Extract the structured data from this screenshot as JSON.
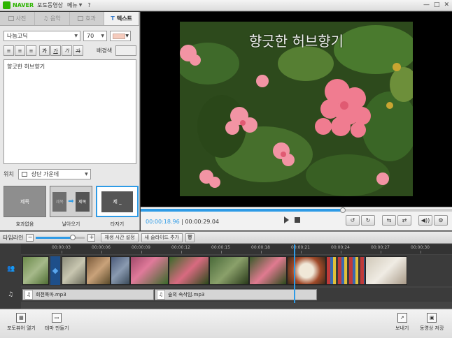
{
  "titlebar": {
    "brand": "NAVER",
    "app_name": "포토동영상",
    "menu": "메뉴",
    "help": "?",
    "minimize": "—",
    "maximize": "□",
    "close": "✕"
  },
  "tabs": [
    {
      "label": "사진",
      "active": false
    },
    {
      "label": "음악",
      "active": false
    },
    {
      "label": "효과",
      "active": false
    },
    {
      "label": "텍스트",
      "active": true
    }
  ],
  "text_panel": {
    "font": "나눔고딕",
    "font_size": "70",
    "text_color": "#f5cbbd",
    "format_buttons": [
      "≡",
      "≡",
      "≡",
      "가",
      "가",
      "가",
      "가"
    ],
    "bg_label": "배경색",
    "text_value": "향긋한 허브향기",
    "position_label": "위치",
    "position_value": "상단 가운데",
    "effects": [
      {
        "thumb": "제목",
        "label": "효과없음"
      },
      {
        "thumb_a": "제목",
        "thumb_b": "제목",
        "label": "날아오기"
      },
      {
        "thumb": "제 _",
        "label": "타자기",
        "active": true
      }
    ]
  },
  "preview": {
    "caption": "향긋한 허브향기"
  },
  "transport": {
    "current_time": "00:00:18.96",
    "separator": "|",
    "total_time": "00:00:29.04",
    "progress": 0.65,
    "buttons": [
      "↺",
      "↻",
      "⇆",
      "⇄",
      "◀))",
      "⚙"
    ]
  },
  "timeline_toolbar": {
    "label": "타임라인",
    "zoom_out": "−",
    "zoom_in": "+",
    "zoom_level": 0.75,
    "play_time_button": "재생 시간 설정",
    "add_slide_button": "새 슬라이드 추가",
    "trash": "🗑"
  },
  "timeline": {
    "ticks": [
      "00:00:03",
      "00:00:06",
      "00:00:09",
      "00:00:12",
      "00:00:15",
      "00:00:18",
      "00:00:21",
      "00:00:24",
      "00:00:27",
      "00:00:30"
    ],
    "playhead": 0.635,
    "audio_clips": [
      {
        "name": "회전목마.mp3"
      },
      {
        "name": "숲의 속삭임.mp3"
      }
    ]
  },
  "bottom": {
    "photo_viewer": "포토뷰어 열기",
    "theme": "테마 만들기",
    "export": "보내기",
    "save": "동영상 저장"
  }
}
